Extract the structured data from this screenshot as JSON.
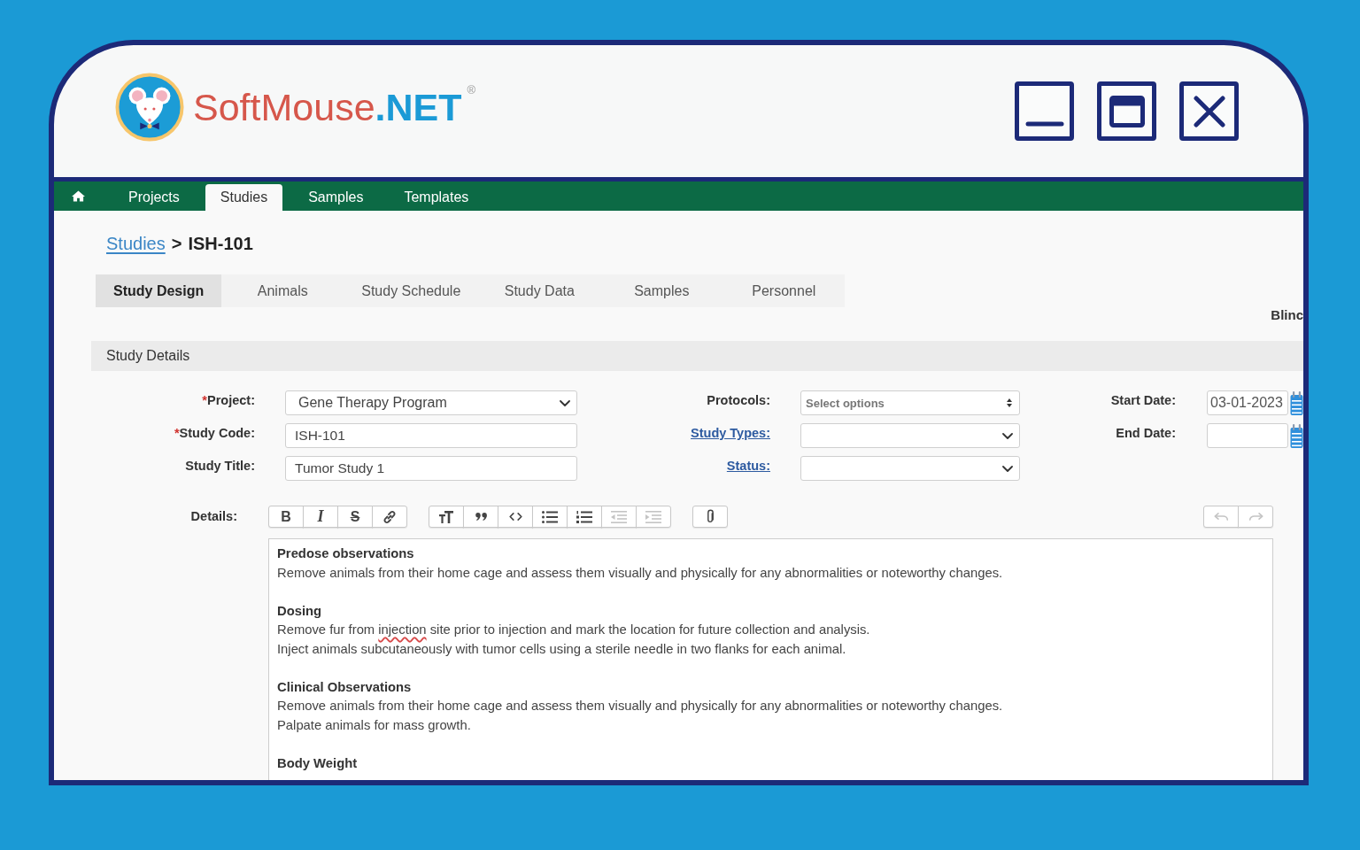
{
  "window": {
    "controls": [
      {
        "kind": "minimize"
      },
      {
        "kind": "maximize"
      },
      {
        "kind": "close"
      }
    ]
  },
  "logo": {
    "name": "SoftMouse",
    "suffix": ".NET",
    "mark": "®"
  },
  "nav": [
    {
      "kind": "home",
      "selected": false
    },
    {
      "kind": "tab",
      "label": "Projects",
      "selected": false
    },
    {
      "kind": "tab",
      "label": "Studies",
      "selected": true
    },
    {
      "kind": "tab",
      "label": "Samples",
      "selected": false
    },
    {
      "kind": "tab",
      "label": "Templates",
      "selected": false
    }
  ],
  "breadcrumb": {
    "link": "Studies",
    "separator": ">",
    "current": "ISH-101"
  },
  "subtabs": [
    {
      "label": "Study Design",
      "selected": true
    },
    {
      "label": "Animals",
      "selected": false
    },
    {
      "label": "Study Schedule",
      "selected": false
    },
    {
      "label": "Study Data",
      "selected": false
    },
    {
      "label": "Samples",
      "selected": false
    },
    {
      "label": "Personnel",
      "selected": false
    }
  ],
  "side_label": "Blinc",
  "study_details": {
    "title": "Study Details",
    "columns": [
      [
        {
          "label": "Project:",
          "mark": "*",
          "link": false,
          "kind": "select",
          "value": "Gene Therapy Program"
        },
        {
          "label": "Study Code:",
          "mark": "*",
          "link": false,
          "kind": "text",
          "value": "ISH-101"
        },
        {
          "label": "Study Title:",
          "link": false,
          "kind": "text",
          "value": "Tumor Study 1"
        }
      ],
      [
        {
          "label": "Protocols:",
          "link": false,
          "kind": "multiselect",
          "placeholder": "Select options"
        },
        {
          "label": "Study Types:",
          "link": true,
          "kind": "select"
        },
        {
          "label": "Status:",
          "link": true,
          "kind": "select"
        }
      ],
      [
        {
          "label": "Start Date:",
          "link": false,
          "kind": "date",
          "value": "03-01-2023"
        },
        {
          "label": "End Date:",
          "link": false,
          "kind": "date"
        }
      ]
    ]
  },
  "details": {
    "label": "Details:",
    "toolbar": [
      [
        {
          "kind": "bold",
          "label": "B",
          "disabled": false
        },
        {
          "kind": "italic",
          "label": "I",
          "disabled": false
        },
        {
          "kind": "strikethrough",
          "label": "S",
          "disabled": false
        },
        {
          "kind": "link",
          "disabled": false
        }
      ],
      [
        {
          "kind": "heading",
          "disabled": false
        },
        {
          "kind": "quote",
          "disabled": false
        },
        {
          "kind": "code",
          "disabled": false
        },
        {
          "kind": "bullet-list",
          "disabled": false
        },
        {
          "kind": "numbered-list",
          "disabled": false
        },
        {
          "kind": "outdent",
          "disabled": true
        },
        {
          "kind": "indent",
          "disabled": true
        }
      ],
      [
        {
          "kind": "attach",
          "disabled": false
        }
      ]
    ],
    "history": [
      {
        "kind": "undo",
        "disabled": true
      },
      {
        "kind": "redo",
        "disabled": true
      }
    ],
    "sections": [
      {
        "heading": "Predose observations",
        "lines": [
          [
            {
              "text": "Remove animals from their home cage and assess them visually and physically for any abnormalities or noteworthy changes.",
              "misspelled": false
            }
          ]
        ]
      },
      {
        "heading": "Dosing",
        "lines": [
          [
            {
              "text": "Remove fur from ",
              "misspelled": false
            },
            {
              "text": "injection",
              "misspelled": true
            },
            {
              "text": " site prior to injection and mark the location for future collection and analysis.",
              "misspelled": false
            }
          ],
          [
            {
              "text": "Inject animals subcutaneously with tumor cells using a sterile needle in two flanks for each animal.",
              "misspelled": false
            }
          ]
        ]
      },
      {
        "heading": "Clinical Observations",
        "lines": [
          [
            {
              "text": "Remove animals from their home cage and assess them visually and physically for any abnormalities or noteworthy changes.",
              "misspelled": false
            }
          ],
          [
            {
              "text": "Palpate animals for mass growth.",
              "misspelled": false
            }
          ]
        ]
      },
      {
        "heading": "Body Weight"
      }
    ]
  }
}
